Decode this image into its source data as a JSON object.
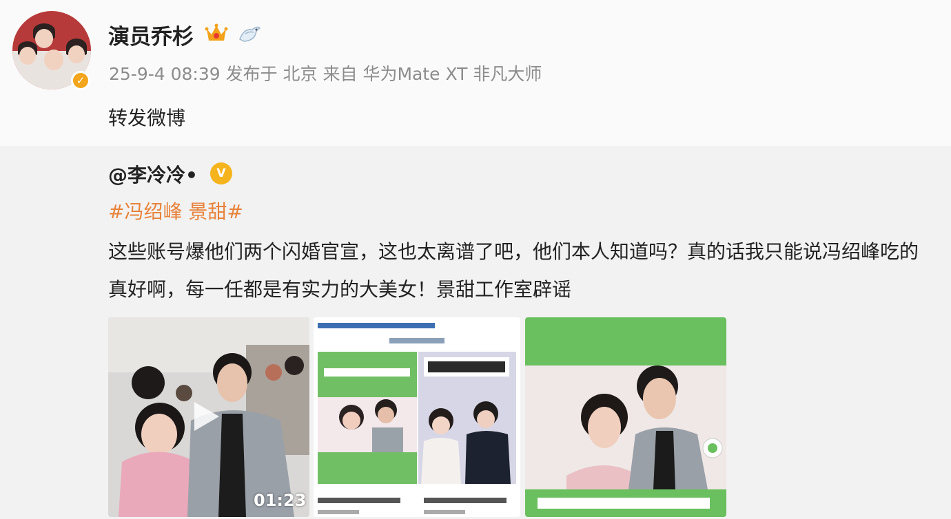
{
  "post": {
    "author": "演员乔杉",
    "icons": [
      "crown-badge-icon",
      "bird-badge-icon"
    ],
    "meta": "25-9-4 08:39 发布于 北京 来自 华为Mate XT 非凡大师",
    "text": "转发微博"
  },
  "repost": {
    "user": "@李冷冷•",
    "topic": "#冯绍峰 景甜#",
    "text": "这些账号爆他们两个闪婚官宣，这也太离谱了吧，他们本人知道吗？真的话我只能说冯绍峰吃的真好啊，每一任都是有实力的大美女！景甜工作室辟谣",
    "video_duration": "01:23"
  },
  "colors": {
    "topic": "#e8823a",
    "verify": "#f3a51b",
    "green": "#6abf5e"
  }
}
